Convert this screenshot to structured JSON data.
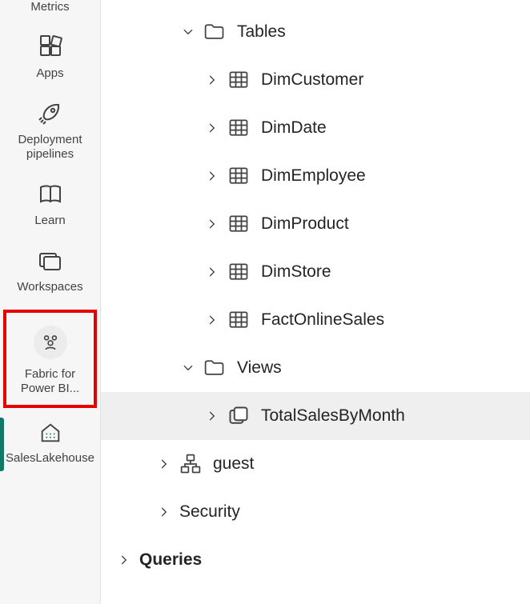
{
  "nav": {
    "items": [
      {
        "label": "Metrics",
        "icon": "metrics-icon",
        "state": ""
      },
      {
        "label": "Apps",
        "icon": "apps-icon",
        "state": ""
      },
      {
        "label": "Deployment pipelines",
        "icon": "rocket-icon",
        "state": ""
      },
      {
        "label": "Learn",
        "icon": "book-icon",
        "state": ""
      },
      {
        "label": "Workspaces",
        "icon": "workspaces-icon",
        "state": ""
      },
      {
        "label": "Fabric for Power BI...",
        "icon": "people-icon",
        "state": "highlighted"
      },
      {
        "label": "SalesLakehouse",
        "icon": "lakehouse-icon",
        "state": "selected"
      }
    ]
  },
  "tree": {
    "nodes": [
      {
        "depth": 2,
        "caret": "down",
        "icon": "folder",
        "label": "Tables",
        "selected": false
      },
      {
        "depth": 3,
        "caret": "right",
        "icon": "table",
        "label": "DimCustomer",
        "selected": false
      },
      {
        "depth": 3,
        "caret": "right",
        "icon": "table",
        "label": "DimDate",
        "selected": false
      },
      {
        "depth": 3,
        "caret": "right",
        "icon": "table",
        "label": "DimEmployee",
        "selected": false
      },
      {
        "depth": 3,
        "caret": "right",
        "icon": "table",
        "label": "DimProduct",
        "selected": false
      },
      {
        "depth": 3,
        "caret": "right",
        "icon": "table",
        "label": "DimStore",
        "selected": false
      },
      {
        "depth": 3,
        "caret": "right",
        "icon": "table",
        "label": "FactOnlineSales",
        "selected": false
      },
      {
        "depth": 2,
        "caret": "down",
        "icon": "folder",
        "label": "Views",
        "selected": false
      },
      {
        "depth": 3,
        "caret": "right",
        "icon": "view",
        "label": "TotalSalesByMonth",
        "selected": true
      },
      {
        "depth": 1,
        "caret": "right",
        "icon": "schema",
        "label": "guest",
        "selected": false
      },
      {
        "depth": 1,
        "caret": "right",
        "icon": "",
        "label": "Security",
        "selected": false
      },
      {
        "depth": 0,
        "caret": "right",
        "icon": "",
        "label": "Queries",
        "selected": false
      }
    ]
  }
}
